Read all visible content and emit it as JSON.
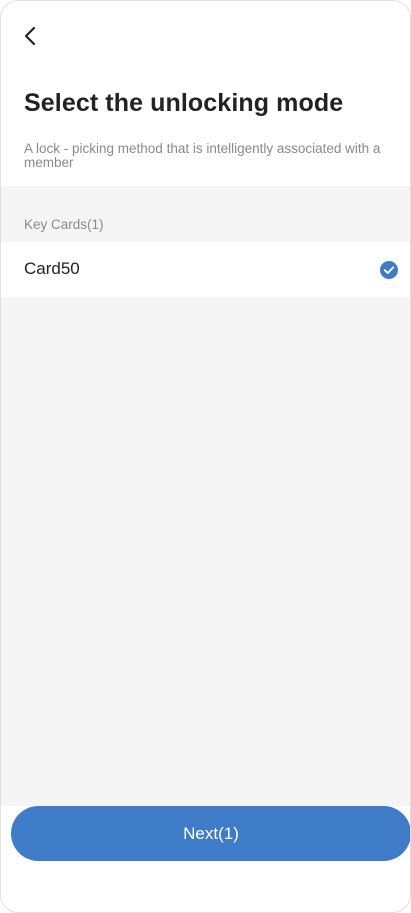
{
  "header": {
    "back_icon": "chevron-left-icon",
    "title": "Select the unlocking mode",
    "subtitle": "A lock - picking method that is intelligently associated with a member"
  },
  "section": {
    "header": "Key Cards(1)",
    "items": [
      {
        "label": "Card50",
        "selected": true,
        "check_icon": "check-circle-icon"
      }
    ]
  },
  "footer": {
    "next_label": "Next(1)"
  },
  "colors": {
    "accent": "#3e7cc8",
    "background": "#f5f5f5",
    "text_primary": "#222222",
    "text_secondary": "#8a8a8a"
  }
}
